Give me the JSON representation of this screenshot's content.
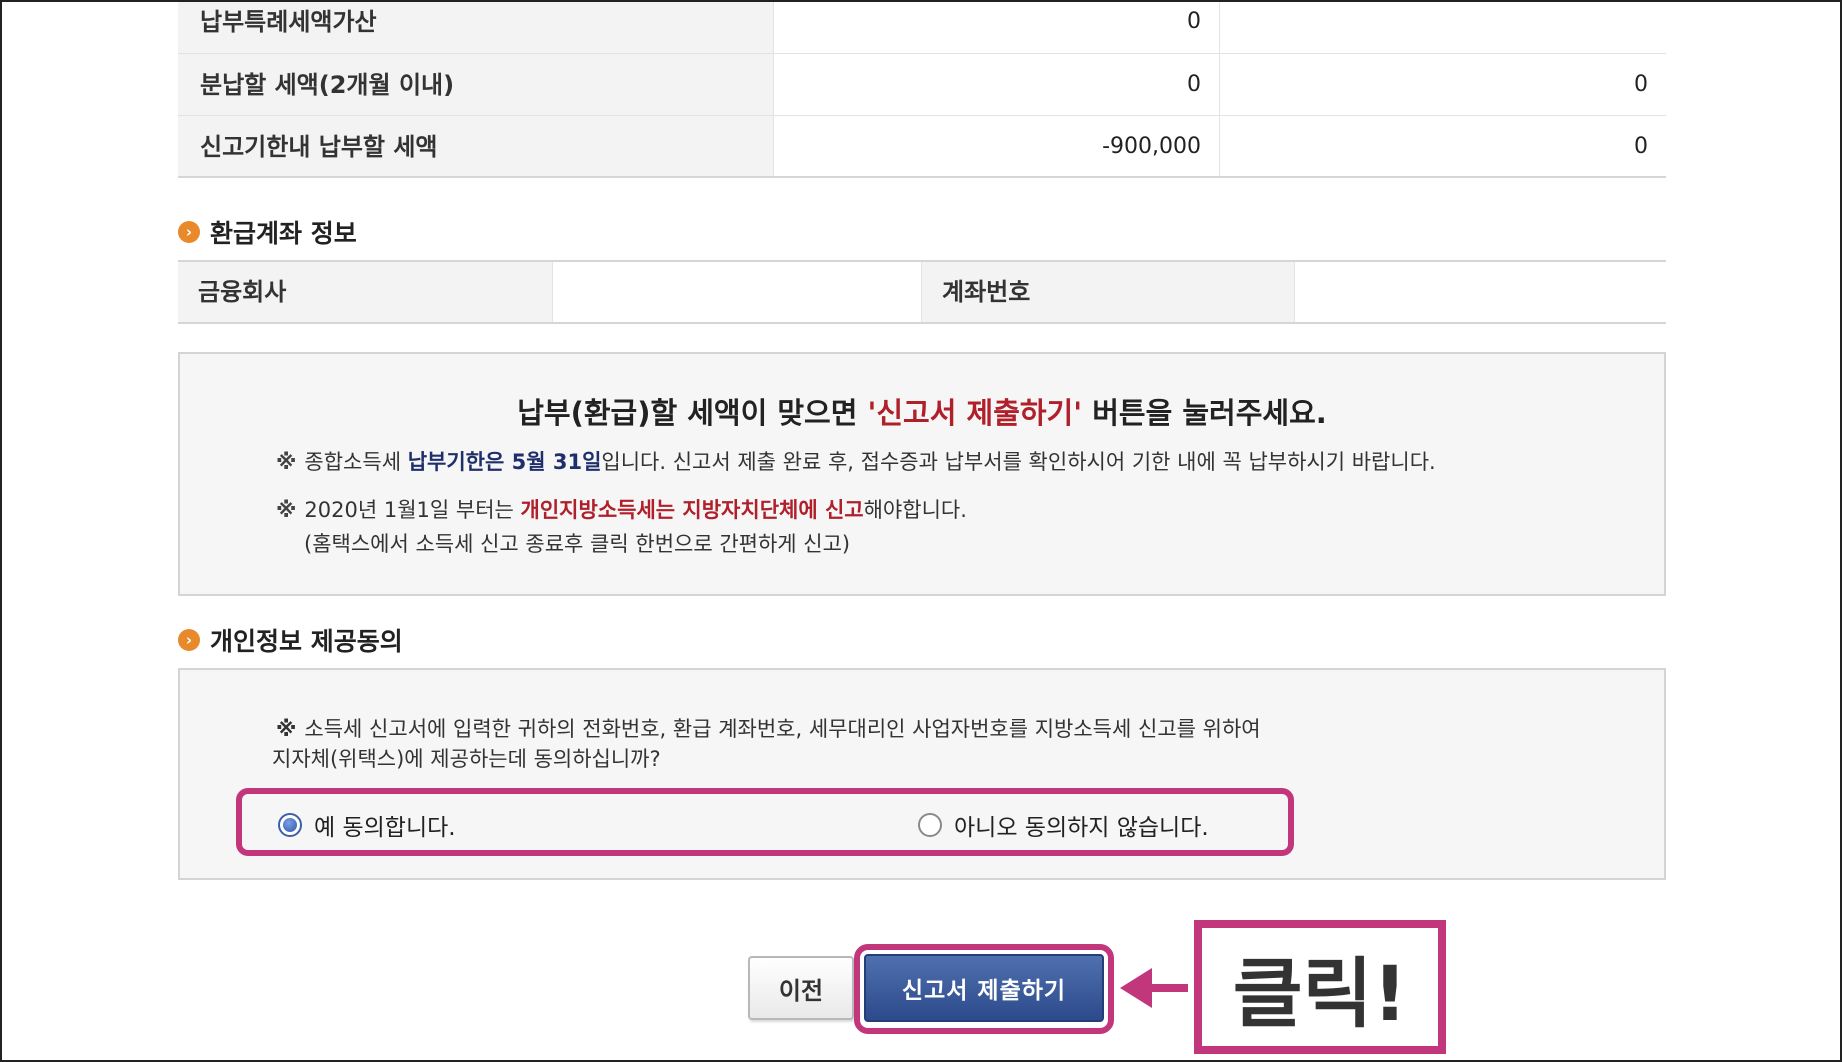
{
  "tax_rows": [
    {
      "label": "납부특례세액가산",
      "col1": "0",
      "col2": ""
    },
    {
      "label": "분납할 세액(2개월 이내)",
      "col1": "0",
      "col2": "0"
    },
    {
      "label": "신고기한내 납부할 세액",
      "col1": "-900,000",
      "col2": "0"
    }
  ],
  "refund_section": {
    "title": "환급계좌 정보",
    "bank_label": "금융회사",
    "bank_value": "",
    "account_label": "계좌번호",
    "account_value": ""
  },
  "notice": {
    "head_pre": "납부(환급)할 세액이 맞으면 ",
    "head_red": "'신고서 제출하기'",
    "head_post": " 버튼을 눌러주세요.",
    "note1_pre": "종합소득세 ",
    "note1_bold": "납부기한은 5월 31일",
    "note1_post": "입니다. 신고서 제출 완료 후, 접수증과 납부서를 확인하시어 기한 내에 꼭 납부하시기 바랍니다.",
    "note2_pre": "2020년 1월1일 부터는 ",
    "note2_bold": "개인지방소득세는 지방자치단체에 신고",
    "note2_post": "해야합니다.",
    "note3": "(홈택스에서 소득세 신고 종료후 클릭 한번으로 간편하게 신고)",
    "star": "※"
  },
  "consent": {
    "title": "개인정보 제공동의",
    "text_line1": "소득세 신고서에 입력한 귀하의 전화번호, 환급 계좌번호, 세무대리인 사업자번호를 지방소득세 신고를 위하여",
    "text_line2": "지자체(위택스)에 제공하는데 동의하십니까?",
    "yes_label": "예 동의합니다.",
    "no_label": "아니오 동의하지 않습니다.",
    "selected": "yes"
  },
  "buttons": {
    "prev": "이전",
    "submit": "신고서 제출하기"
  },
  "callout": {
    "text": "클릭!",
    "color": "#c2377c"
  }
}
